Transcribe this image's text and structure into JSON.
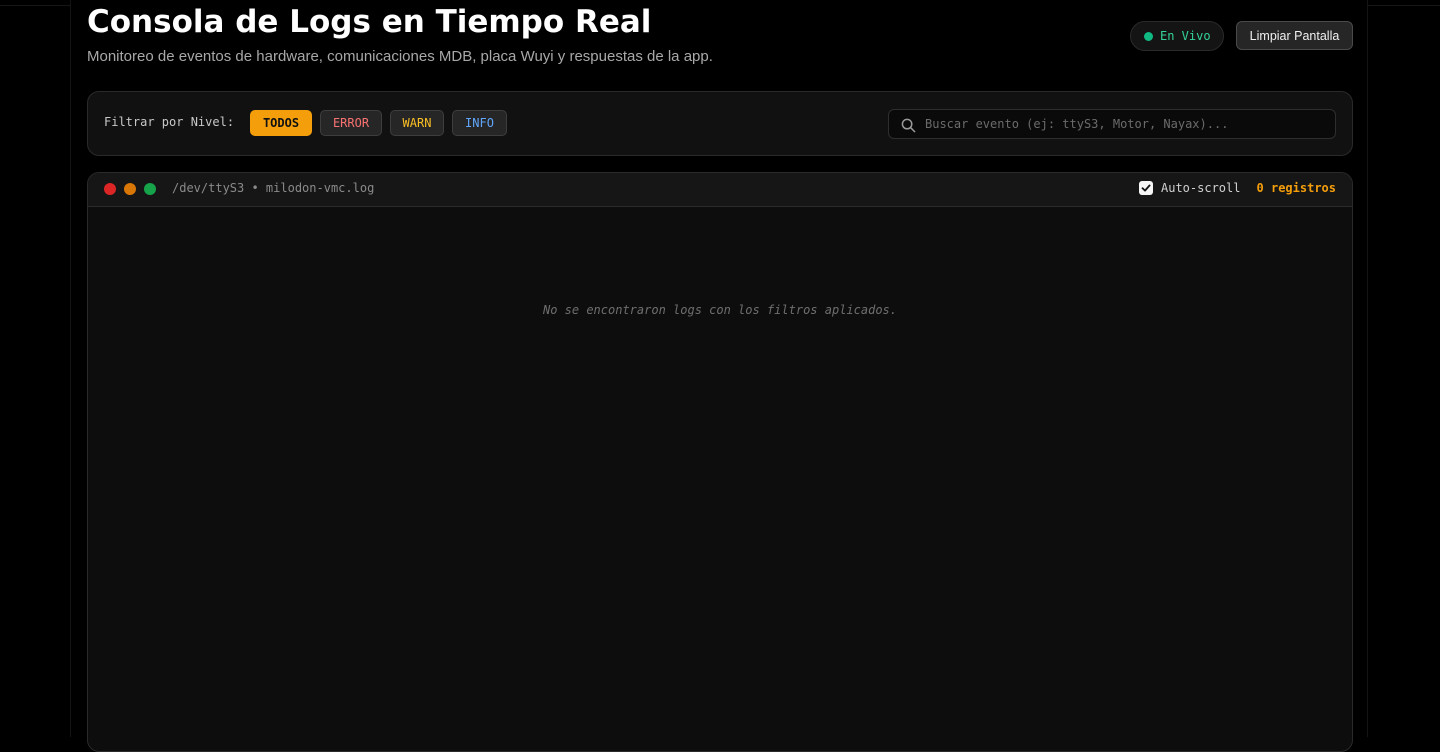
{
  "header": {
    "title": "Consola de Logs en Tiempo Real",
    "subtitle": "Monitoreo de eventos de hardware, comunicaciones MDB, placa Wuyi y respuestas de la app.",
    "live_badge": "En Vivo",
    "clear_button": "Limpiar Pantalla"
  },
  "filters": {
    "label": "Filtrar por Nivel:",
    "levels": [
      "TODOS",
      "ERROR",
      "WARN",
      "INFO"
    ],
    "active_level": "TODOS",
    "search_placeholder": "Buscar evento (ej: ttyS3, Motor, Nayax)...",
    "search_value": ""
  },
  "console": {
    "path": "/dev/ttyS3 • milodon-vmc.log",
    "autoscroll_label": "Auto-scroll",
    "autoscroll_checked": true,
    "records": "0 registros",
    "empty_message": "No se encontraron logs con los filtros aplicados."
  },
  "colors": {
    "accent": "#f59e0b",
    "live": "#10b981",
    "error": "#f87171",
    "warn": "#fbbf24",
    "info": "#60a5fa"
  },
  "icons": {
    "search": "search-icon",
    "checkbox": "check-icon",
    "window_controls": [
      "red-dot",
      "orange-dot",
      "green-dot"
    ]
  }
}
